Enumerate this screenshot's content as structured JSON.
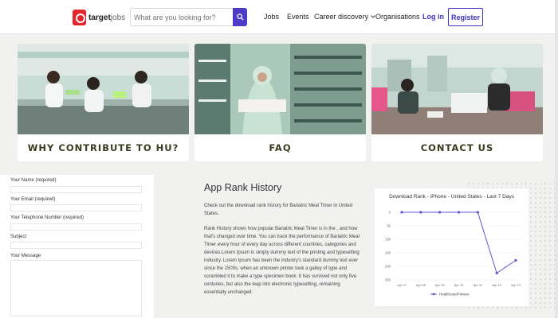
{
  "header": {
    "logo_text": "target",
    "logo_suffix": "jobs",
    "search_placeholder": "What are you looking for?",
    "nav": {
      "jobs": "Jobs",
      "events": "Events",
      "career": "Career discovery",
      "orgs": "Organisations"
    },
    "login": "Log in",
    "register": "Register"
  },
  "cards": [
    {
      "title": "WHY CONTRIBUTE TO HU?"
    },
    {
      "title": "FAQ"
    },
    {
      "title": "CONTACT US"
    }
  ],
  "form": {
    "name_label": "Your Name (required)",
    "email_label": "Your Email (required)",
    "phone_label": "Your Telephone Number (required)",
    "subject_label": "Subject",
    "message_label": "Your Message"
  },
  "article": {
    "title": "App Rank History",
    "p1": "Check out the download rank history for Bariatric Meal Timer in United States.",
    "p2": "Rank History shows how popular Bariatric Meal Timer is in the , and how that's changed over time. You can track the performance of Bariatric Meal Timer every hour of every day across different countries, categories and devices.Lorem Ipsum is simply dummy text of the printing and typesetting industry. Lorem Ipsum has been the industry's standard dummy text ever since the 1500s, when an unknown printer took a galley of type and scrambled it to make a type specimen book. It has survived not only five centuries, but also the leap into electronic typesetting, remaining essentially unchanged."
  },
  "colors": {
    "accent": "#3f33c0",
    "brand_red": "#e3262b",
    "series_line": "#5b55d6"
  },
  "chart_data": {
    "type": "line",
    "title": "Download Rank - iPhone - United States - Last 7 Days",
    "categories": [
      "Apr 07",
      "Apr 08",
      "Apr 09",
      "Apr 10",
      "Apr 11",
      "Apr 12",
      "Apr 13"
    ],
    "yticks": [
      0,
      50,
      100,
      150,
      200,
      250
    ],
    "ylim": [
      0,
      250
    ],
    "y_inverted": true,
    "series": [
      {
        "name": "Healthcare/Fitness",
        "values": [
          0,
          0,
          0,
          0,
          0,
          225,
          178
        ]
      }
    ],
    "legend": "bottom"
  }
}
